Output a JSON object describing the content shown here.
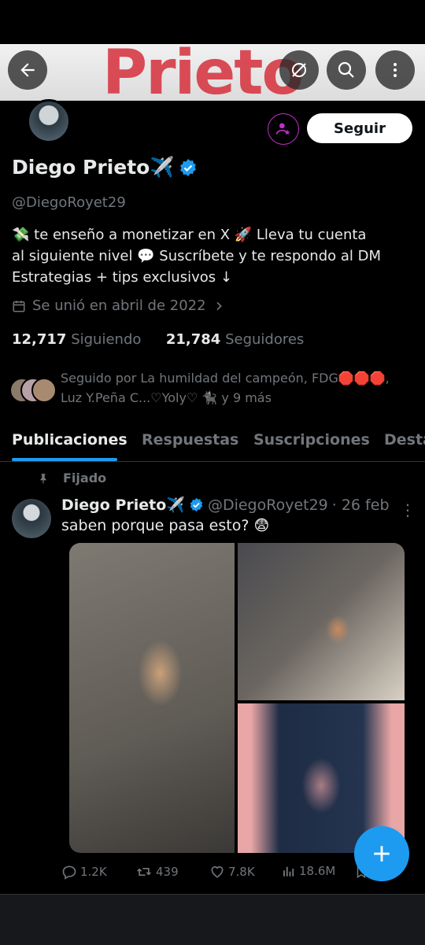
{
  "banner": {
    "text": "Prieto"
  },
  "header": {
    "back_icon": "arrow-left-icon",
    "grok_icon": "grok-icon",
    "search_icon": "search-icon",
    "more_icon": "more-vertical-icon"
  },
  "profile": {
    "name": "Diego Prieto✈️",
    "handle": "@DiegoRoyet29",
    "follow_label": "Seguir",
    "bio_line1": "💸 te enseño a monetizar en X 🚀 Lleva tu cuenta",
    "bio_line2": "al siguiente nivel 💬 Suscríbete y te respondo al DM",
    "bio_line3": "Estrategias + tips exclusivos ↓",
    "joined": "Se unió en abril de 2022",
    "following_count": "12,717",
    "following_label": "Siguiendo",
    "followers_count": "21,784",
    "followers_label": "Seguidores",
    "followed_by_line1": "Seguido por La humildad del campeón, FDG🛑🛑🛑,",
    "followed_by_line2": "Luz Y.Peña C...♡Yoly♡ 🐈‍⬛ y 9 más"
  },
  "tabs": [
    "Publicaciones",
    "Respuestas",
    "Suscripciones",
    "Desta"
  ],
  "post": {
    "pinned_label": "Fijado",
    "author": "Diego Prieto✈️",
    "handle": "@DiegoRoyet29",
    "date": "· 26 feb",
    "text": "saben porque pasa esto? 😨",
    "replies": "1.2K",
    "reposts": "439",
    "likes": "7.8K",
    "views": "18.6M"
  },
  "colors": {
    "accent": "#1d9bf0",
    "verified": "#1d9bf0",
    "background": "#000000",
    "muted": "#71767b"
  }
}
